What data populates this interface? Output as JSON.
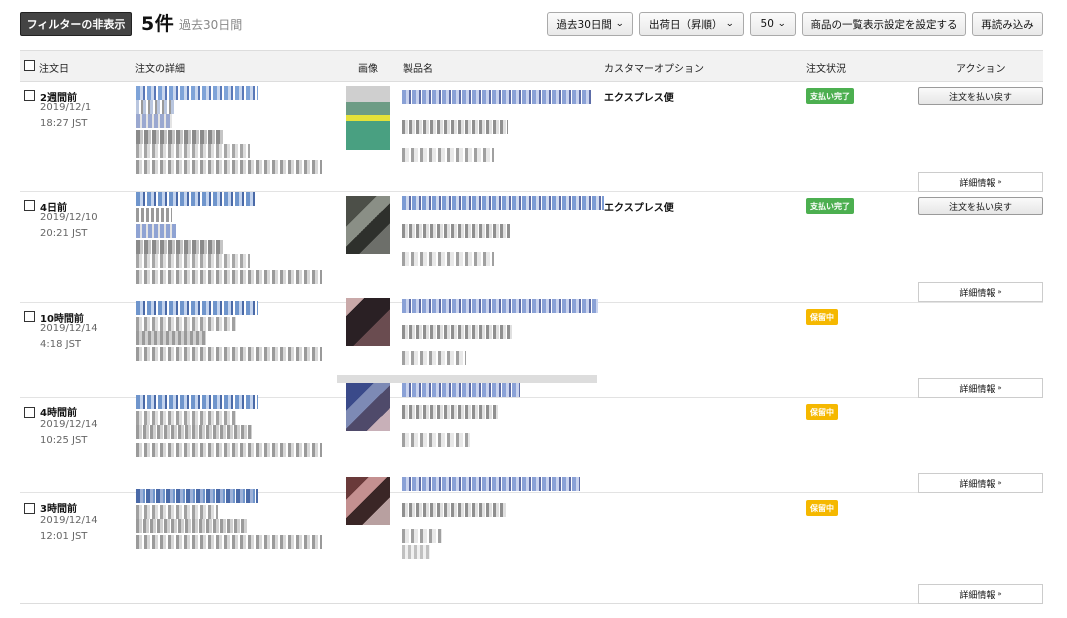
{
  "toolbar": {
    "hide_filters": "フィルターの非表示",
    "count": "5件",
    "range_label": "過去30日間",
    "date_filter": "過去30日間",
    "sort": "出荷日（昇順）",
    "per_page": "50",
    "display_settings": "商品の一覧表示設定を設定する",
    "reload": "再読み込み"
  },
  "columns": {
    "order_date": "注文日",
    "order_details": "注文の詳細",
    "image": "画像",
    "product_name": "製品名",
    "customer_option": "カスタマーオプション",
    "status": "注文状況",
    "action": "アクション"
  },
  "orders": [
    {
      "relative": "2週間前",
      "date": "2019/12/1",
      "time": "18:27 JST",
      "option": "エクスプレス便",
      "status": "支払い完了",
      "refund": "注文を払い戻す",
      "details": "詳細情報"
    },
    {
      "relative": "4日前",
      "date": "2019/12/10",
      "time": "20:21 JST",
      "option": "エクスプレス便",
      "status": "支払い完了",
      "refund": "注文を払い戻す",
      "details": "詳細情報"
    },
    {
      "relative": "10時間前",
      "date": "2019/12/14",
      "time": "4:18 JST",
      "option": "",
      "status": "保留中",
      "refund": "",
      "details": "詳細情報"
    },
    {
      "relative": "4時間前",
      "date": "2019/12/14",
      "time": "10:25 JST",
      "option": "",
      "status": "保留中",
      "refund": "",
      "details": "詳細情報"
    },
    {
      "relative": "3時間前",
      "date": "2019/12/14",
      "time": "12:01 JST",
      "option": "",
      "status": "保留中",
      "refund": "",
      "details": "詳細情報"
    }
  ],
  "icons": {
    "dropdown": "chevron-down-icon",
    "expand": "double-chevron-down-icon"
  },
  "colors": {
    "paid": "#4caf50",
    "pending": "#f5b800",
    "dark_button": "#444444"
  }
}
